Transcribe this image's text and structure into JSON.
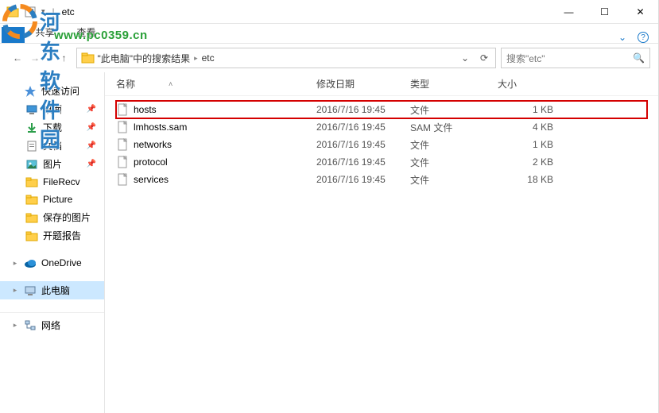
{
  "title": {
    "sep": "|",
    "folder_name": "etc"
  },
  "window_controls": {
    "minimize": "—",
    "maximize": "☐",
    "close": "✕"
  },
  "ribbon": {
    "tabs": [
      "共享",
      "查看"
    ],
    "help_icon": "?",
    "expand_icon": "⌄"
  },
  "nav": {
    "back": "←",
    "forward": "→",
    "recent": "⌄",
    "up": "↑",
    "breadcrumb": [
      "\"此电脑\"中的搜索结果",
      "etc"
    ],
    "dropdown": "⌄",
    "refresh": "⟳"
  },
  "search": {
    "placeholder": "搜索\"etc\"",
    "icon": "🔍"
  },
  "sidebar": {
    "quick_access": "快速访问",
    "items": [
      {
        "label": "桌面",
        "pinned": true
      },
      {
        "label": "下载",
        "pinned": true
      },
      {
        "label": "文档",
        "pinned": true
      },
      {
        "label": "图片",
        "pinned": true
      },
      {
        "label": "FileRecv",
        "pinned": false
      },
      {
        "label": "Picture",
        "pinned": false
      },
      {
        "label": "保存的图片",
        "pinned": false
      },
      {
        "label": "开题报告",
        "pinned": false
      }
    ],
    "onedrive": "OneDrive",
    "this_pc": "此电脑",
    "network": "网络"
  },
  "columns": {
    "name": "名称",
    "date": "修改日期",
    "type": "类型",
    "size": "大小"
  },
  "files": [
    {
      "name": "hosts",
      "date": "2016/7/16 19:45",
      "type": "文件",
      "size": "1 KB",
      "hl": true
    },
    {
      "name": "lmhosts.sam",
      "date": "2016/7/16 19:45",
      "type": "SAM 文件",
      "size": "4 KB",
      "hl": false
    },
    {
      "name": "networks",
      "date": "2016/7/16 19:45",
      "type": "文件",
      "size": "1 KB",
      "hl": false
    },
    {
      "name": "protocol",
      "date": "2016/7/16 19:45",
      "type": "文件",
      "size": "2 KB",
      "hl": false
    },
    {
      "name": "services",
      "date": "2016/7/16 19:45",
      "type": "文件",
      "size": "18 KB",
      "hl": false
    }
  ],
  "watermark": {
    "line1": "河东软件园",
    "line2": "www.pc0359.cn"
  },
  "icons": {
    "pin": "📌"
  }
}
